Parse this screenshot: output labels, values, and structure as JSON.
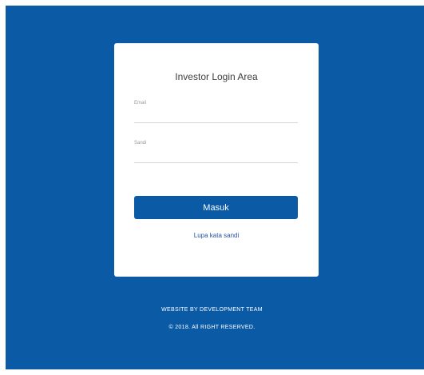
{
  "login": {
    "title": "Investor Login Area",
    "email_label": "Email",
    "email_value": "",
    "password_label": "Sandi",
    "password_value": "",
    "submit_label": "Masuk",
    "forgot_label": "Lupa kata sandi"
  },
  "footer": {
    "credit": "WEBSITE BY DEVELOPMENT TEAM",
    "copyright": "© 2018. All RIGHT RESERVED."
  },
  "colors": {
    "background": "#0b5aa6",
    "card": "#ffffff",
    "button": "#0b5aa6",
    "link": "#2350a8"
  }
}
